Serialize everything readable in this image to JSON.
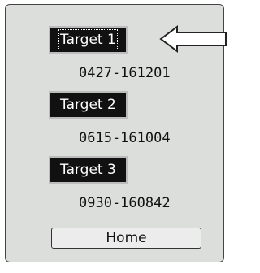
{
  "targets": [
    {
      "label": "Target 1",
      "code": "0427-161201",
      "selected": true
    },
    {
      "label": "Target 2",
      "code": "0615-161004",
      "selected": false
    },
    {
      "label": "Target 3",
      "code": "0930-160842",
      "selected": false
    }
  ],
  "home_label": "Home",
  "icons": {
    "pointer": "left-arrow-icon"
  },
  "colors": {
    "panel_bg": "#dcdedc",
    "button_bg": "#111111",
    "button_text": "#ffffff"
  }
}
